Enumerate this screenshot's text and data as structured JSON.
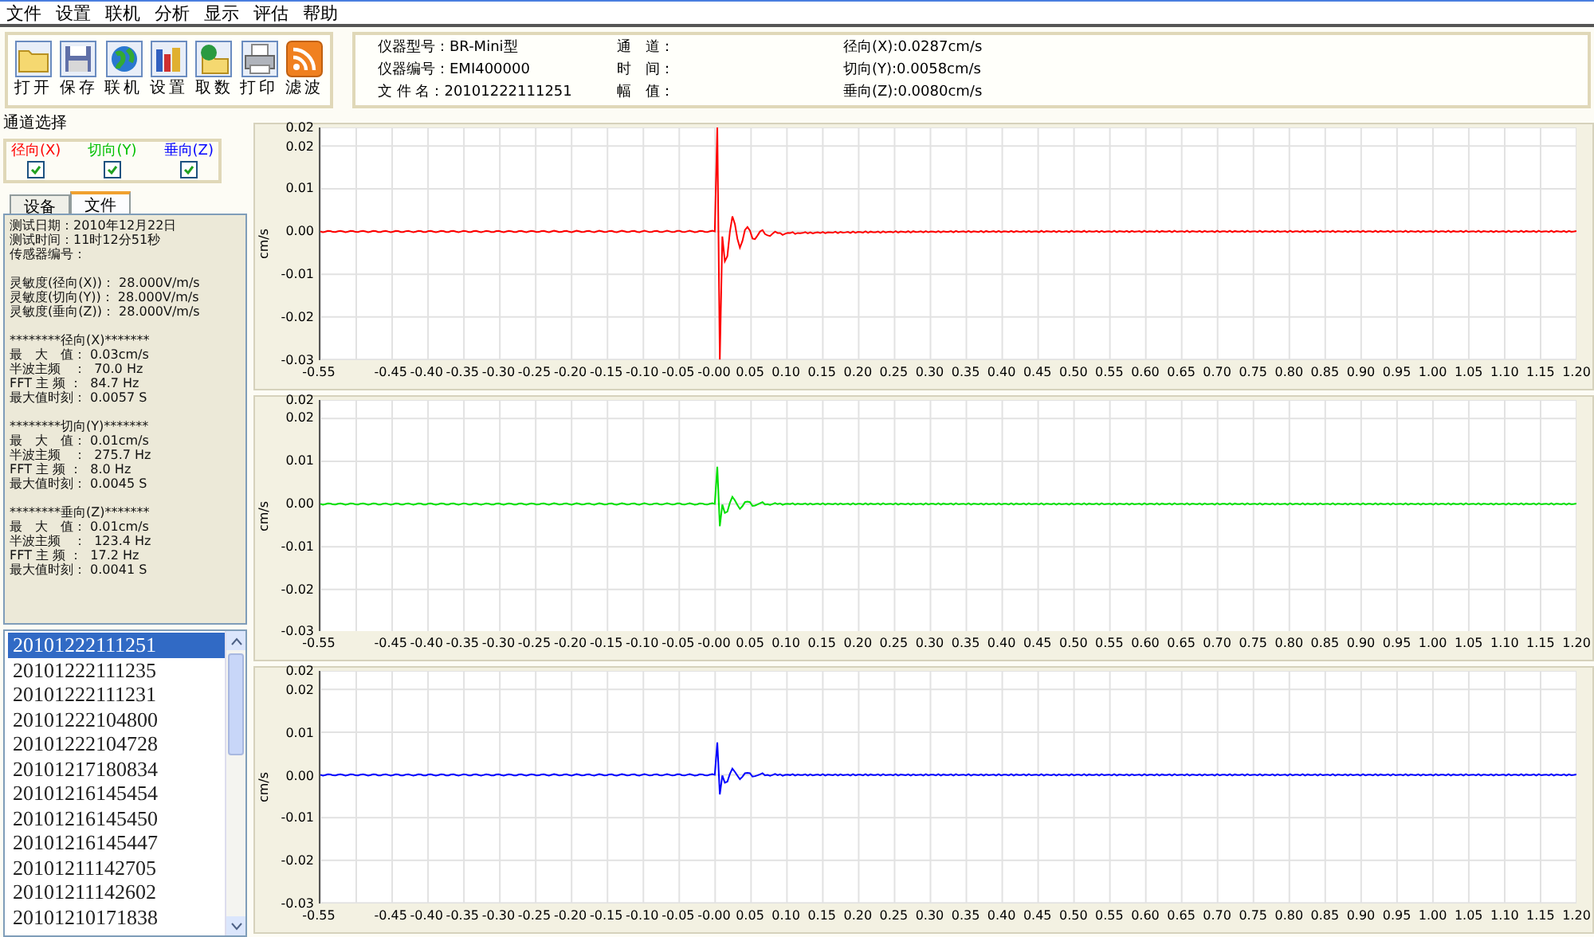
{
  "menu": [
    "文件",
    "设置",
    "联机",
    "分析",
    "显示",
    "评估",
    "帮助"
  ],
  "toolbar": [
    {
      "label": "打开",
      "kind": "open"
    },
    {
      "label": "保存",
      "kind": "save"
    },
    {
      "label": "联机",
      "kind": "online"
    },
    {
      "label": "设置",
      "kind": "settings"
    },
    {
      "label": "取数",
      "kind": "fetch"
    },
    {
      "label": "打印",
      "kind": "print"
    },
    {
      "label": "滤波",
      "kind": "filter"
    }
  ],
  "info": {
    "column_1": [
      {
        "label": "仪器型号：",
        "value": "BR-Mini型"
      },
      {
        "label": "仪器编号：",
        "value": "EMI400000"
      },
      {
        "label": "文 件 名：",
        "value": "20101222111251"
      }
    ],
    "column_2": [
      "通　道：",
      "时　间：",
      "幅　值："
    ],
    "column_3": [
      "径向(X):0.0287cm/s",
      "切向(Y):0.0058cm/s",
      "垂向(Z):0.0080cm/s"
    ]
  },
  "channel_select": {
    "title": "通道选择",
    "channels": [
      {
        "label": "径向(X)",
        "color": "#ff0000",
        "checked": true
      },
      {
        "label": "切向(Y)",
        "color": "#00c000",
        "checked": true
      },
      {
        "label": "垂向(Z)",
        "color": "#0000ff",
        "checked": true
      }
    ]
  },
  "tabs": [
    {
      "label": "设备",
      "selected": false
    },
    {
      "label": "文件",
      "selected": true
    }
  ],
  "details": [
    [
      "测试日期：2010年12月22日",
      "测试时间：11时12分51秒",
      "传感器编号："
    ],
    [
      "灵敏度(径向(X))： 28.000V/m/s",
      "灵敏度(切向(Y))： 28.000V/m/s",
      "灵敏度(垂向(Z))： 28.000V/m/s"
    ],
    [
      "********径向(X)*******",
      "最　大　值： 0.03cm/s",
      "半波主频　：  70.0 Hz",
      "FFT 主 频 ：  84.7 Hz",
      "最大值时刻： 0.0057 S"
    ],
    [
      "********切向(Y)*******",
      "最　大　值： 0.01cm/s",
      "半波主频　：  275.7 Hz",
      "FFT 主 频 ：  8.0 Hz",
      "最大值时刻： 0.0045 S"
    ],
    [
      "********垂向(Z)*******",
      "最　大　值： 0.01cm/s",
      "半波主频　：  123.4 Hz",
      "FFT 主 频 ：  17.2 Hz",
      "最大值时刻： 0.0041 S"
    ]
  ],
  "files": [
    {
      "name": "20101222111251",
      "selected": true
    },
    {
      "name": "20101222111235",
      "selected": false
    },
    {
      "name": "20101222111231",
      "selected": false
    },
    {
      "name": "20101222104800",
      "selected": false
    },
    {
      "name": "20101222104728",
      "selected": false
    },
    {
      "name": "20101217180834",
      "selected": false
    },
    {
      "name": "20101216145454",
      "selected": false
    },
    {
      "name": "20101216145450",
      "selected": false
    },
    {
      "name": "20101216145447",
      "selected": false
    },
    {
      "name": "20101211142705",
      "selected": false
    },
    {
      "name": "20101211142602",
      "selected": false
    },
    {
      "name": "20101210171838",
      "selected": false
    }
  ],
  "charts": [
    {
      "unit": "cm/s",
      "color": "#ff0000",
      "y_ticks": [
        "0.02",
        "0.02",
        "0.01",
        "0.00",
        "-0.01",
        "-0.02",
        "-0.03"
      ],
      "x_ticks": [
        "-0.55",
        "-0.45",
        "-0.40",
        "-0.35",
        "-0.30",
        "-0.25",
        "-0.20",
        "-0.15",
        "-0.10",
        "-0.05",
        "-0.00",
        "0.05",
        "0.10",
        "0.15",
        "0.20",
        "0.25",
        "0.30",
        "0.35",
        "0.40",
        "0.45",
        "0.50",
        "0.55",
        "0.60",
        "0.65",
        "0.70",
        "0.75",
        "0.80",
        "0.85",
        "0.90",
        "0.95",
        "1.00",
        "1.05",
        "1.10",
        "1.15",
        "1.20"
      ]
    },
    {
      "unit": "cm/s",
      "color": "#00e000",
      "y_ticks": [
        "0.02",
        "0.02",
        "0.01",
        "0.00",
        "-0.01",
        "-0.02",
        "-0.03"
      ],
      "x_ticks": [
        "-0.55",
        "-0.45",
        "-0.40",
        "-0.35",
        "-0.30",
        "-0.25",
        "-0.20",
        "-0.15",
        "-0.10",
        "-0.05",
        "-0.00",
        "0.05",
        "0.10",
        "0.15",
        "0.20",
        "0.25",
        "0.30",
        "0.35",
        "0.40",
        "0.45",
        "0.50",
        "0.55",
        "0.60",
        "0.65",
        "0.70",
        "0.75",
        "0.80",
        "0.85",
        "0.90",
        "0.95",
        "1.00",
        "1.05",
        "1.10",
        "1.15",
        "1.20"
      ]
    },
    {
      "unit": "cm/s",
      "color": "#0000ff",
      "y_ticks": [
        "0.02",
        "0.02",
        "0.01",
        "0.00",
        "-0.01",
        "-0.02",
        "-0.03"
      ],
      "x_ticks": [
        "-0.55",
        "-0.45",
        "-0.40",
        "-0.35",
        "-0.30",
        "-0.25",
        "-0.20",
        "-0.15",
        "-0.10",
        "-0.05",
        "-0.00",
        "0.05",
        "0.10",
        "0.15",
        "0.20",
        "0.25",
        "0.30",
        "0.35",
        "0.40",
        "0.45",
        "0.50",
        "0.55",
        "0.60",
        "0.65",
        "0.70",
        "0.75",
        "0.80",
        "0.85",
        "0.90",
        "0.95",
        "1.00",
        "1.05",
        "1.10",
        "1.15",
        "1.20"
      ]
    }
  ]
}
